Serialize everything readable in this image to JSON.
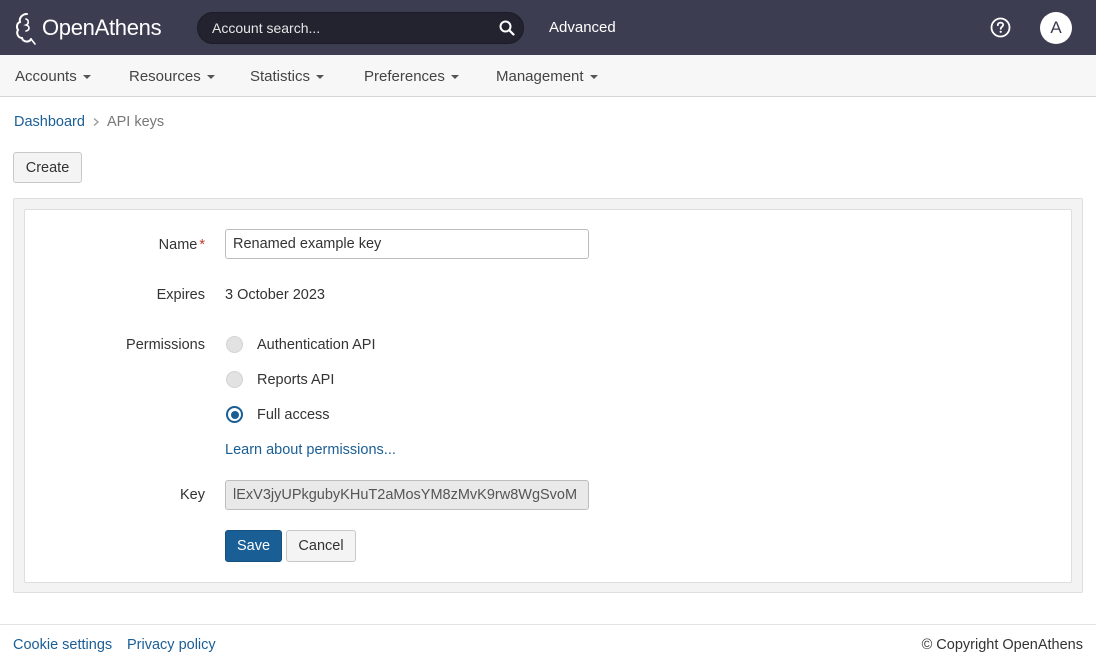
{
  "header": {
    "brand": "OpenAthens",
    "search_placeholder": "Account search...",
    "advanced_label": "Advanced",
    "avatar_initial": "A"
  },
  "nav": {
    "items": [
      {
        "label": "Accounts"
      },
      {
        "label": "Resources"
      },
      {
        "label": "Statistics"
      },
      {
        "label": "Preferences"
      },
      {
        "label": "Management"
      }
    ]
  },
  "breadcrumb": {
    "home": "Dashboard",
    "current": "API keys"
  },
  "toolbar": {
    "create_label": "Create"
  },
  "form": {
    "name_label": "Name",
    "required_mark": "*",
    "name_value": "Renamed example key",
    "expires_label": "Expires",
    "expires_value": "3 October 2023",
    "permissions_label": "Permissions",
    "permissions": [
      {
        "label": "Authentication API",
        "checked": false
      },
      {
        "label": "Reports API",
        "checked": false
      },
      {
        "label": "Full access",
        "checked": true
      }
    ],
    "learn_link": "Learn about permissions...",
    "key_label": "Key",
    "key_value": "lExV3jyUPkgubyKHuT2aMosYM8zMvK9rw8WgSvoM",
    "save_label": "Save",
    "cancel_label": "Cancel"
  },
  "footer": {
    "cookie_settings": "Cookie settings",
    "privacy_policy": "Privacy policy",
    "copyright": "© Copyright OpenAthens"
  },
  "colors": {
    "header_bg": "#3d3d52",
    "primary": "#1a5e96",
    "required": "#c0392b"
  }
}
